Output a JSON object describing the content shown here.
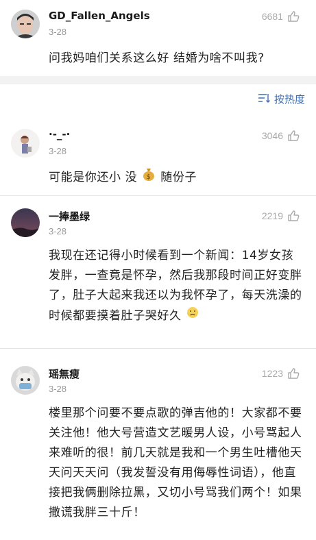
{
  "top_post": {
    "username": "GD_Fallen_Angels",
    "date": "3-28",
    "likes": "6681",
    "text": "问我妈咱们关系这么好 结婚为啥不叫我?"
  },
  "sort": {
    "label": "按热度"
  },
  "comments": [
    {
      "username": "·-_-·",
      "date": "3-28",
      "likes": "3046",
      "text_before": "可能是你还小 没",
      "emoji": "money-bag",
      "text_after": "随份子"
    },
    {
      "username": "一捧墨绿",
      "date": "3-28",
      "likes": "2219",
      "text": "我现在还记得小时候看到一个新闻：14岁女孩发胖，一查竟是怀孕，然后我那段时间正好变胖了，肚子大起来我还以为我怀孕了，每天洗澡的时候都要摸着肚子哭好久",
      "emoji": "sad-face"
    },
    {
      "username": "瑶無瘦",
      "date": "3-28",
      "likes": "1223",
      "text": "楼里那个问要不要点歌的弹吉他的！大家都不要关注他！他大号营造文艺暖男人设，小号骂起人来难听的很！前几天就是我和一个男生吐槽他天天问天天问（我发誓没有用侮辱性词语），他直接把我俩删除拉黑，又切小号骂我们两个！如果撒谎我胖三十斤！"
    }
  ],
  "colors": {
    "link": "#3d6fb4",
    "muted": "#999999",
    "band": "#f2f2f2"
  }
}
